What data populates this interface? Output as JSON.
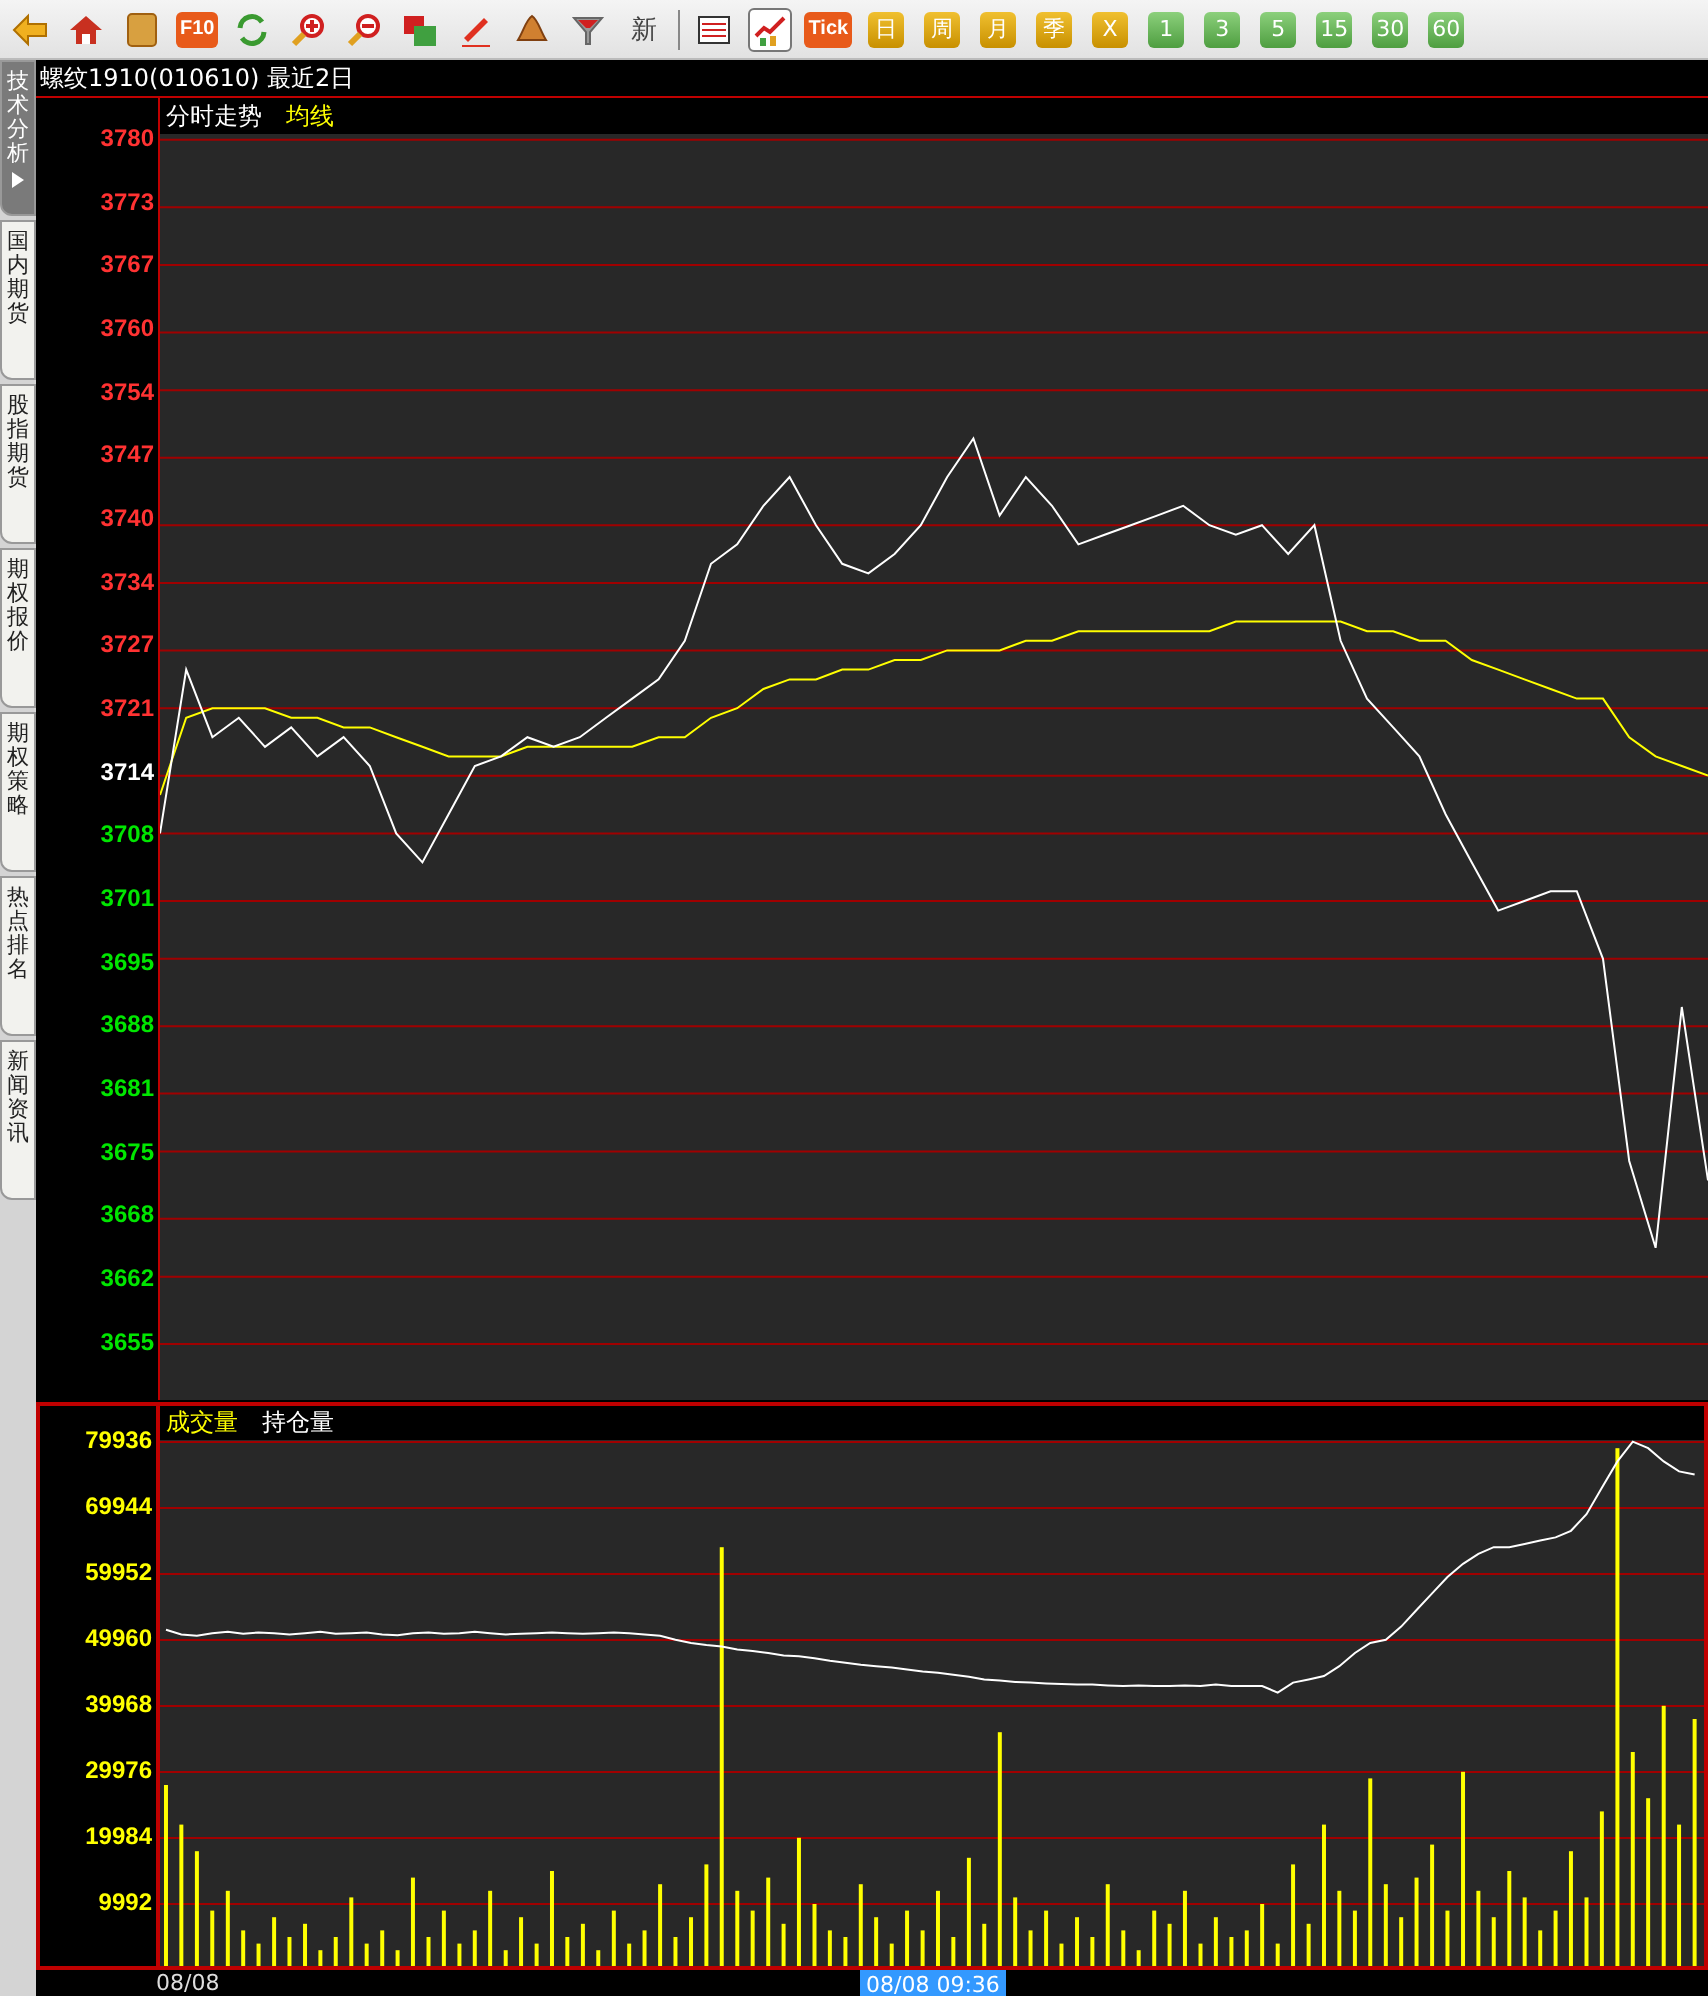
{
  "toolbar": {
    "tools": [
      {
        "kind": "back"
      },
      {
        "kind": "home"
      },
      {
        "kind": "notes"
      },
      {
        "kind": "badge",
        "label": "F10"
      },
      {
        "kind": "refresh"
      },
      {
        "kind": "zoom_in"
      },
      {
        "kind": "zoom_out"
      },
      {
        "kind": "windows"
      },
      {
        "kind": "pen"
      },
      {
        "kind": "bell"
      },
      {
        "kind": "filter"
      },
      {
        "kind": "text",
        "label": "新"
      }
    ],
    "view_buttons": [
      {
        "kind": "table",
        "selected": false
      },
      {
        "kind": "chart",
        "selected": true
      }
    ],
    "tick": "Tick",
    "periods": [
      {
        "label": "日",
        "kind": "gold"
      },
      {
        "label": "周",
        "kind": "gold"
      },
      {
        "label": "月",
        "kind": "gold"
      },
      {
        "label": "季",
        "kind": "gold"
      },
      {
        "label": "X",
        "kind": "gold"
      },
      {
        "label": "1",
        "kind": "green"
      },
      {
        "label": "3",
        "kind": "green"
      },
      {
        "label": "5",
        "kind": "green"
      },
      {
        "label": "15",
        "kind": "green"
      },
      {
        "label": "30",
        "kind": "green"
      },
      {
        "label": "60",
        "kind": "green"
      }
    ]
  },
  "side_tabs": [
    {
      "label": "技术分析",
      "selected": true
    },
    {
      "label": "国内期货",
      "selected": false
    },
    {
      "label": "股指期货",
      "selected": false
    },
    {
      "label": "期权报价",
      "selected": false
    },
    {
      "label": "期权策略",
      "selected": false
    },
    {
      "label": "热点排名",
      "selected": false
    },
    {
      "label": "新闻资讯",
      "selected": false
    }
  ],
  "chart_title": "螺纹1910(010610) 最近2日",
  "price_panel": {
    "chart_data": {
      "type": "line",
      "grid": true,
      "ylim": [
        3649.2,
        3780.6
      ],
      "yticks": [
        3780,
        3773,
        3767,
        3760,
        3754,
        3747,
        3740,
        3734,
        3727,
        3721,
        3714,
        3708,
        3701,
        3695,
        3688,
        3681,
        3675,
        3668,
        3662,
        3655
      ],
      "series": [
        {
          "name": "分时走势",
          "color": "#ffffff",
          "values": [
            3708,
            3725,
            3718,
            3720,
            3717,
            3719,
            3716,
            3718,
            3715,
            3708,
            3705,
            3710,
            3715,
            3716,
            3718,
            3717,
            3718,
            3720,
            3722,
            3724,
            3728,
            3736,
            3738,
            3742,
            3745,
            3740,
            3736,
            3735,
            3737,
            3740,
            3745,
            3749,
            3741,
            3745,
            3742,
            3738,
            3739,
            3740,
            3741,
            3742,
            3740,
            3739,
            3740,
            3737,
            3740,
            3728,
            3722,
            3719,
            3716,
            3710,
            3705,
            3700,
            3701,
            3702,
            3702,
            3695,
            3674,
            3665,
            3690,
            3672
          ]
        },
        {
          "name": "均线",
          "color": "#ffff00",
          "values": [
            3712,
            3720,
            3721,
            3721,
            3721,
            3720,
            3720,
            3719,
            3719,
            3718,
            3717,
            3716,
            3716,
            3716,
            3717,
            3717,
            3717,
            3717,
            3717,
            3718,
            3718,
            3720,
            3721,
            3723,
            3724,
            3724,
            3725,
            3725,
            3726,
            3726,
            3727,
            3727,
            3727,
            3728,
            3728,
            3729,
            3729,
            3729,
            3729,
            3729,
            3729,
            3730,
            3730,
            3730,
            3730,
            3730,
            3729,
            3729,
            3728,
            3728,
            3726,
            3725,
            3724,
            3723,
            3722,
            3722,
            3718,
            3716,
            3715,
            3714
          ]
        }
      ]
    }
  },
  "volume_panel": {
    "chart_data": {
      "type": "bar",
      "grid": true,
      "ylim": [
        605.8,
        80238.8
      ],
      "yticks": [
        79936,
        69944,
        59952,
        49960,
        39968,
        29976,
        19984,
        9992
      ],
      "series": [
        {
          "name": "成交量",
          "color": "#ffff00",
          "type": "bar",
          "values": [
            28000,
            22000,
            18000,
            9000,
            12000,
            6000,
            4000,
            8000,
            5000,
            7000,
            3000,
            5000,
            11000,
            4000,
            6000,
            3000,
            14000,
            5000,
            9000,
            4000,
            6000,
            12000,
            3000,
            8000,
            4000,
            15000,
            5000,
            7000,
            3000,
            9000,
            4000,
            6000,
            13000,
            5000,
            8000,
            16000,
            64000,
            12000,
            9000,
            14000,
            7000,
            20000,
            10000,
            6000,
            5000,
            13000,
            8000,
            4000,
            9000,
            6000,
            12000,
            5000,
            17000,
            7000,
            36000,
            11000,
            6000,
            9000,
            4000,
            8000,
            5000,
            13000,
            6000,
            3000,
            9000,
            7000,
            12000,
            4000,
            8000,
            5000,
            6000,
            10000,
            4000,
            16000,
            7000,
            22000,
            12000,
            9000,
            29000,
            13000,
            8000,
            14000,
            19000,
            9000,
            30000,
            12000,
            8000,
            15000,
            11000,
            6000,
            9000,
            18000,
            11000,
            24000,
            79000,
            33000,
            26000,
            40000,
            22000,
            38000
          ]
        },
        {
          "name": "持仓量",
          "color": "#ffffff",
          "type": "line",
          "values": [
            51500,
            50800,
            50600,
            51000,
            51200,
            50900,
            51100,
            51000,
            50800,
            51000,
            51200,
            50900,
            51000,
            51100,
            50800,
            50700,
            51000,
            51100,
            50900,
            51000,
            51200,
            51000,
            50800,
            50900,
            51000,
            51100,
            51000,
            50900,
            51000,
            51100,
            51000,
            50800,
            50600,
            50000,
            49500,
            49200,
            49000,
            48500,
            48300,
            48000,
            47600,
            47500,
            47200,
            46800,
            46500,
            46200,
            46000,
            45800,
            45500,
            45200,
            45000,
            44700,
            44400,
            44000,
            43800,
            43600,
            43500,
            43400,
            43300,
            43200,
            43200,
            43100,
            43000,
            43100,
            43000,
            43000,
            43100,
            43000,
            43200,
            43000,
            43000,
            43000,
            42000,
            43500,
            44000,
            44500,
            46000,
            48000,
            49500,
            50000,
            52000,
            54500,
            57000,
            59500,
            61500,
            63000,
            64000,
            64000,
            64500,
            65000,
            65500,
            66500,
            69000,
            73000,
            77000,
            80000,
            79000,
            77000,
            75500,
            75000
          ]
        }
      ]
    }
  },
  "time_axis": {
    "start": "08/08",
    "cursor": "08/08 09:36"
  }
}
